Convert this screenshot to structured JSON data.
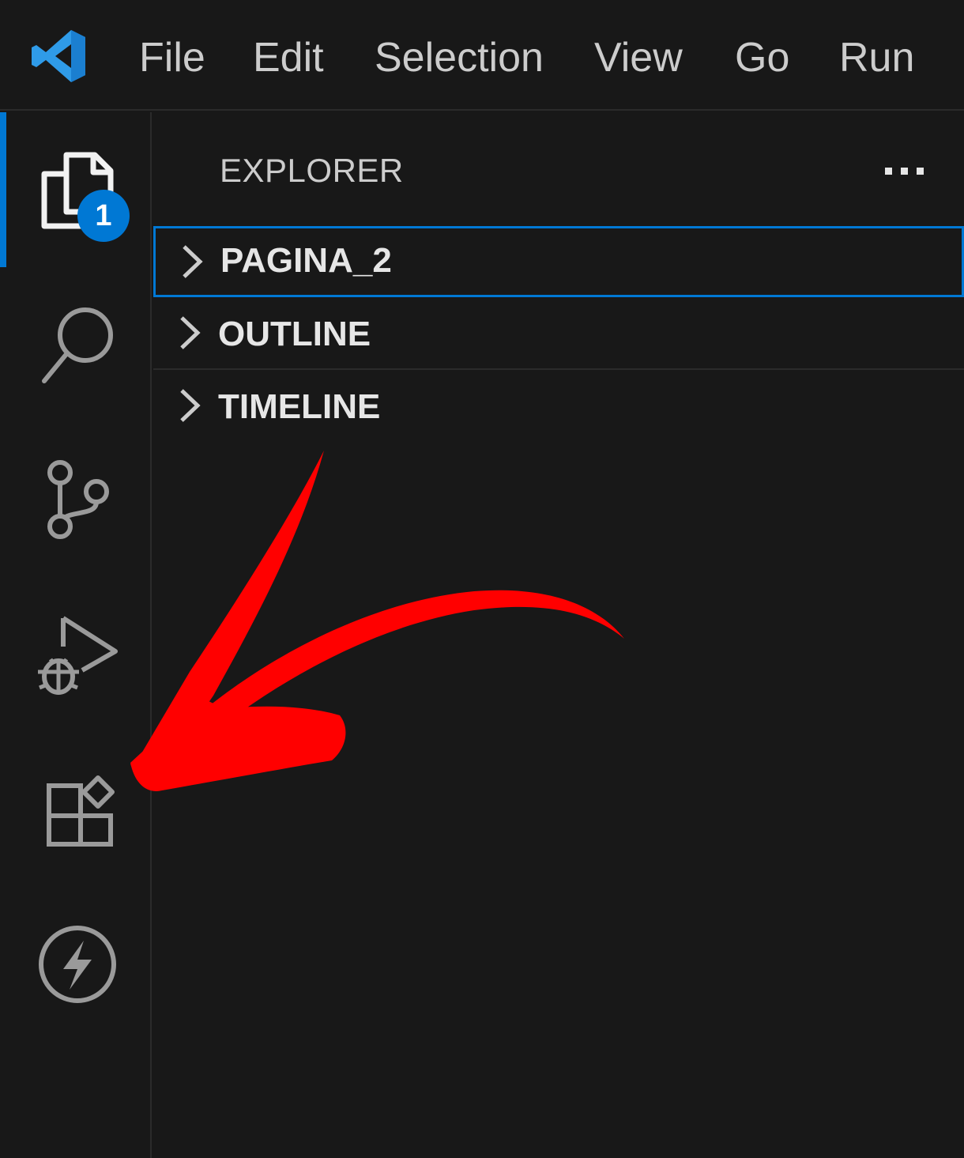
{
  "menubar": {
    "app_icon": "vscode-logo-icon",
    "items": [
      {
        "label": "File"
      },
      {
        "label": "Edit"
      },
      {
        "label": "Selection"
      },
      {
        "label": "View"
      },
      {
        "label": "Go"
      },
      {
        "label": "Run"
      }
    ]
  },
  "activity_bar": {
    "items": [
      {
        "icon": "explorer-icon",
        "badge": "1",
        "active": true
      },
      {
        "icon": "search-icon"
      },
      {
        "icon": "source-control-icon"
      },
      {
        "icon": "run-and-debug-icon"
      },
      {
        "icon": "extensions-icon"
      },
      {
        "icon": "lightning-icon"
      }
    ]
  },
  "sidebar": {
    "title": "EXPLORER",
    "more_actions_icon": "ellipsis-icon",
    "sections": [
      {
        "label": "PAGINA_2",
        "expanded": false,
        "focused": true
      },
      {
        "label": "OUTLINE",
        "expanded": false
      },
      {
        "label": "TIMELINE",
        "expanded": false
      }
    ]
  },
  "annotation": {
    "type": "arrow",
    "color": "#ff0000",
    "points_to": "extensions-icon"
  },
  "colors": {
    "background": "#181818",
    "accent": "#0078d4",
    "icon": "#cccccc",
    "annotation": "#ff0000"
  }
}
